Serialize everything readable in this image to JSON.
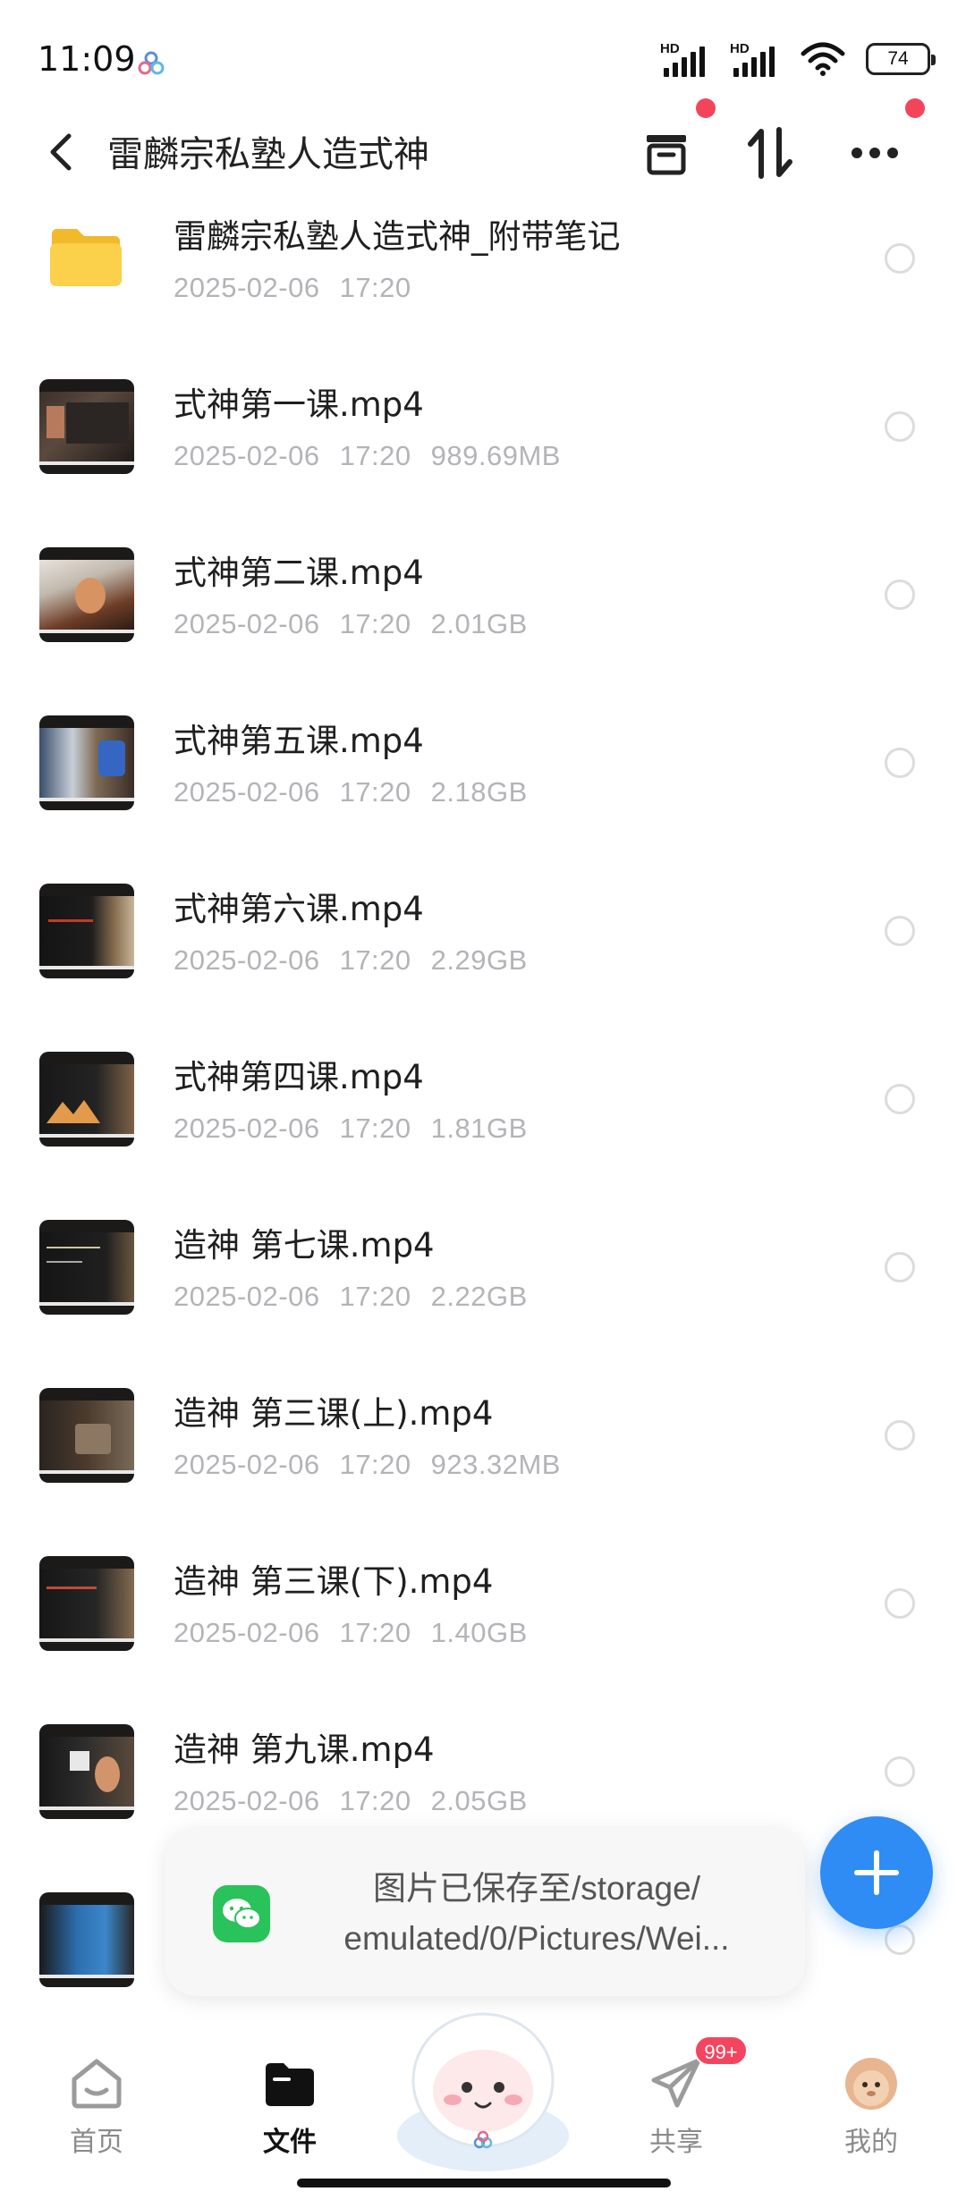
{
  "status_bar": {
    "time": "11:09",
    "signal1_label": "HD",
    "signal2_label": "HD",
    "battery": "74"
  },
  "header": {
    "title": "雷麟宗私塾人造式神",
    "back_icon": "chevron-left-icon",
    "actions": [
      "archive-icon",
      "sort-icon",
      "more-icon"
    ]
  },
  "files": [
    {
      "name": "雷麟宗私塾人造式神_附带笔记",
      "date": "2025-02-06",
      "time": "17:20",
      "size": "",
      "type": "folder"
    },
    {
      "name": "式神第一课.mp4",
      "date": "2025-02-06",
      "time": "17:20",
      "size": "989.69MB",
      "type": "video"
    },
    {
      "name": "式神第二课.mp4",
      "date": "2025-02-06",
      "time": "17:20",
      "size": "2.01GB",
      "type": "video"
    },
    {
      "name": "式神第五课.mp4",
      "date": "2025-02-06",
      "time": "17:20",
      "size": "2.18GB",
      "type": "video"
    },
    {
      "name": "式神第六课.mp4",
      "date": "2025-02-06",
      "time": "17:20",
      "size": "2.29GB",
      "type": "video"
    },
    {
      "name": "式神第四课.mp4",
      "date": "2025-02-06",
      "time": "17:20",
      "size": "1.81GB",
      "type": "video"
    },
    {
      "name": "造神 第七课.mp4",
      "date": "2025-02-06",
      "time": "17:20",
      "size": "2.22GB",
      "type": "video"
    },
    {
      "name": "造神 第三课(上).mp4",
      "date": "2025-02-06",
      "time": "17:20",
      "size": "923.32MB",
      "type": "video"
    },
    {
      "name": "造神 第三课(下).mp4",
      "date": "2025-02-06",
      "time": "17:20",
      "size": "1.40GB",
      "type": "video"
    },
    {
      "name": "造神 第九课.mp4",
      "date": "2025-02-06",
      "time": "17:20",
      "size": "2.05GB",
      "type": "video"
    },
    {
      "name": "",
      "date": "",
      "time": "",
      "size": "",
      "type": "video"
    }
  ],
  "toast": {
    "line1": "图片已保存至/storage/",
    "line2": "emulated/0/Pictures/Wei..."
  },
  "bottom_nav": {
    "items": [
      {
        "label": "首页",
        "icon": "home-icon"
      },
      {
        "label": "文件",
        "icon": "folder-icon"
      },
      {
        "label": "共享",
        "icon": "send-icon"
      },
      {
        "label": "我的",
        "icon": "avatar-icon"
      }
    ],
    "share_badge": "99+"
  },
  "colors": {
    "accent": "#2f8cf5",
    "badge": "#f44560",
    "meta_text": "#b4b4b8",
    "folder": "#f8c73a",
    "wechat": "#2ac25a"
  }
}
